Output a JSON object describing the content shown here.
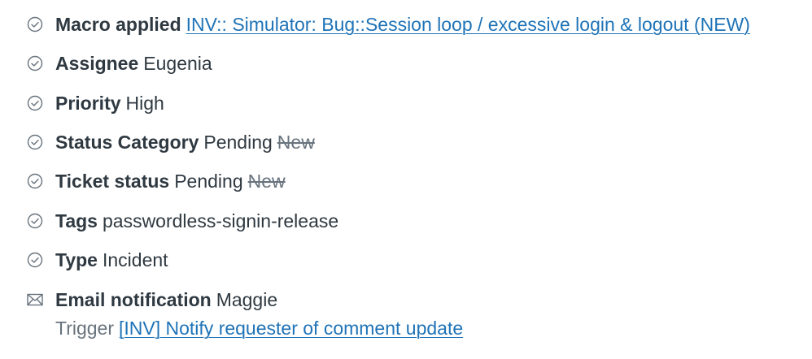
{
  "events": [
    {
      "icon": "check-circle-icon",
      "label": "Macro applied",
      "link": "INV:: Simulator: Bug::Session loop / excessive login & logout (NEW)"
    },
    {
      "icon": "check-circle-icon",
      "label": "Assignee",
      "value": "Eugenia"
    },
    {
      "icon": "check-circle-icon",
      "label": "Priority",
      "value": "High"
    },
    {
      "icon": "check-circle-icon",
      "label": "Status Category",
      "value": "Pending",
      "old": "New"
    },
    {
      "icon": "check-circle-icon",
      "label": "Ticket status",
      "value": "Pending",
      "old": "New"
    },
    {
      "icon": "check-circle-icon",
      "label": "Tags",
      "value": "passwordless-signin-release"
    },
    {
      "icon": "check-circle-icon",
      "label": "Type",
      "value": "Incident"
    },
    {
      "icon": "envelope-icon",
      "label": "Email notification",
      "value": "Maggie",
      "trigger_label": "Trigger",
      "trigger_link": "[INV] Notify requester of comment update"
    }
  ],
  "colors": {
    "text": "#2f3941",
    "muted": "#68737d",
    "link": "#1f73b7",
    "icon": "#68737d"
  }
}
